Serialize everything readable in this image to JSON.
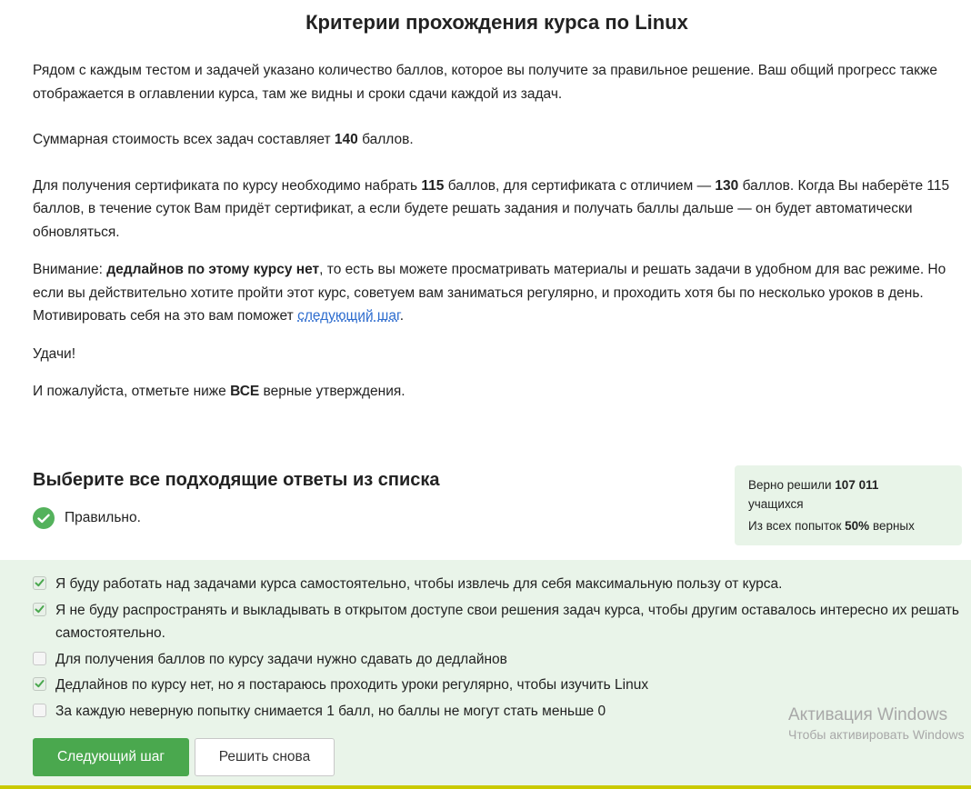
{
  "page": {
    "title": "Критерии прохождения курса по Linux"
  },
  "intro": {
    "p1": "Рядом с каждым тестом и задачей указано количество баллов, которое вы получите за правильное решение. Ваш общий прогресс также отображается в оглавлении курса, там же видны и сроки сдачи каждой из задач.",
    "p2_before": "Суммарная стоимость всех задач составляет ",
    "p2_bold": "140",
    "p2_after": " баллов.",
    "p3_a": "Для получения сертификата по курсу необходимо набрать ",
    "p3_b": "115",
    "p3_c": " баллов, для сертификата с отличием — ",
    "p3_d": "130",
    "p3_e": " баллов. Когда Вы наберёте 115 баллов, в течение суток Вам придёт сертификат, а если будете решать задания и получать баллы дальше — он будет автоматически обновляться.",
    "p4_a": "Внимание: ",
    "p4_b": "дедлайнов по этому курсу нет",
    "p4_c": ", то есть вы можете просматривать материалы и решать задачи в удобном для вас режиме. Но если вы действительно хотите пройти этот курс, советуем вам заниматься регулярно, и проходить хотя бы по несколько уроков в день. Мотивировать себя на это вам поможет ",
    "p4_link": "следующий шаг",
    "p4_d": ".",
    "p5": "Удачи!",
    "p6_a": "И пожалуйста, отметьте ниже ",
    "p6_b": "ВСЕ",
    "p6_c": " верные утверждения."
  },
  "quiz": {
    "heading": "Выберите все подходящие ответы из списка",
    "result": "Правильно.",
    "answers": [
      {
        "label": "Я буду работать над задачами курса самостоятельно, чтобы извлечь для себя максимальную пользу от курса.",
        "checked": true
      },
      {
        "label": "Я не буду распространять и выкладывать в открытом доступе свои решения задач курса, чтобы другим оставалось интересно их решать самостоятельно.",
        "checked": true
      },
      {
        "label": "Для получения баллов по курсу задачи нужно сдавать до дедлайнов",
        "checked": false
      },
      {
        "label": "Дедлайнов по курсу нет, но я постараюсь проходить уроки регулярно, чтобы изучить Linux",
        "checked": true
      },
      {
        "label": "За каждую неверную попытку снимается 1 балл, но баллы не могут стать меньше 0",
        "checked": false
      }
    ],
    "next_button": "Следующий шаг",
    "retry_button": "Решить снова"
  },
  "stats": {
    "solved_prefix": "Верно решили ",
    "solved_count": "107 011",
    "solved_suffix": "учащихся",
    "attempts_prefix": "Из всех попыток ",
    "attempts_percent": "50%",
    "attempts_suffix": " верных"
  },
  "watermark": {
    "line1": "Активация Windows",
    "line2": "Чтобы активировать Windows"
  },
  "colors": {
    "accent_green": "#4aa84e",
    "answers_bg": "#e9f4e9",
    "stats_bg": "#e8f4e8",
    "link": "#2f6ecf"
  },
  "icons": {
    "result": "check-circle-icon",
    "checked": "checkbox-checked-icon",
    "unchecked": "checkbox-unchecked-icon"
  }
}
